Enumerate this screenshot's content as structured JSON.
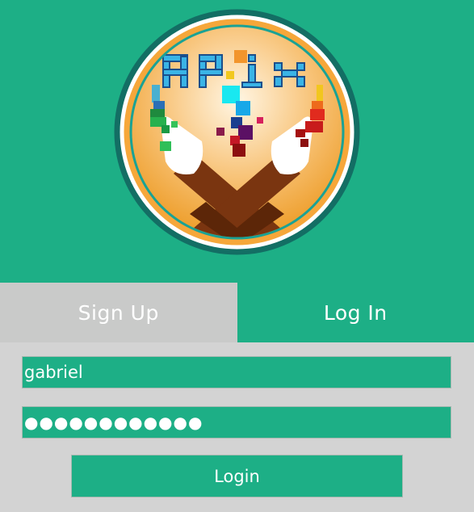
{
  "logo": {
    "text_letters": [
      "A",
      "P",
      "i",
      "x"
    ]
  },
  "tabs": [
    {
      "label": "Sign Up",
      "active": false
    },
    {
      "label": "Log In",
      "active": true
    }
  ],
  "form": {
    "username_value": "gabriel",
    "password_mask": "●●●●●●●●●●●●",
    "login_label": "Login"
  },
  "colors": {
    "accent": "#1daf86",
    "inactive_tab": "#c9cac9",
    "background": "#d3d3d3"
  }
}
